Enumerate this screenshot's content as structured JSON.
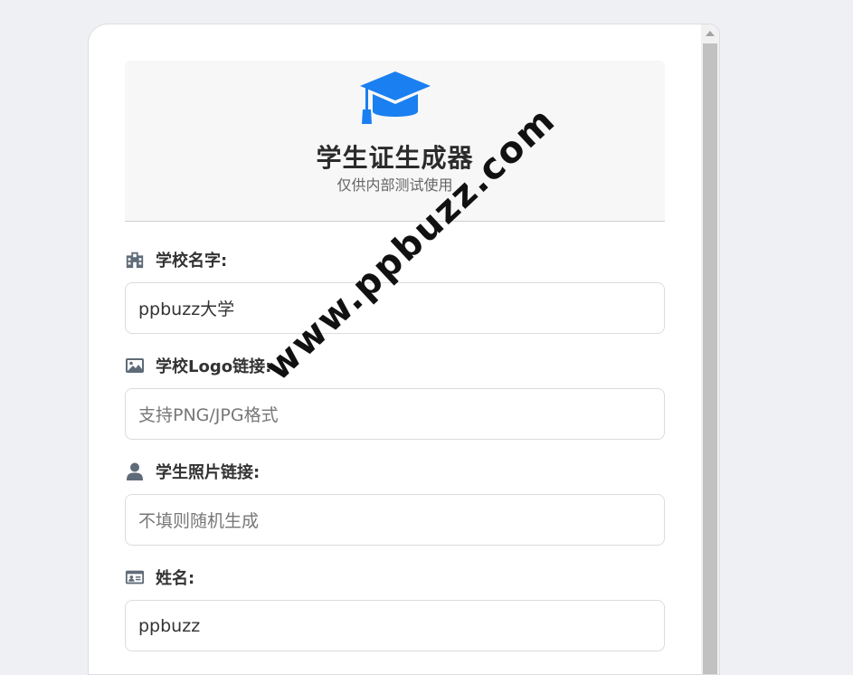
{
  "header": {
    "title": "学生证生成器",
    "subtitle": "仅供内部测试使用"
  },
  "fields": [
    {
      "label": "学校名字:",
      "icon": "school-icon",
      "value": "ppbuzz大学",
      "placeholder": ""
    },
    {
      "label": "学校Logo链接:",
      "icon": "image-icon",
      "value": "",
      "placeholder": "支持PNG/JPG格式"
    },
    {
      "label": "学生照片链接:",
      "icon": "user-icon",
      "value": "",
      "placeholder": "不填则随机生成"
    },
    {
      "label": "姓名:",
      "icon": "id-card-icon",
      "value": "ppbuzz",
      "placeholder": ""
    }
  ],
  "watermark": "www.ppbuzz.com",
  "colors": {
    "accent": "#1a7ff0",
    "icon_gray": "#5f6b78",
    "background": "#eff0f4"
  }
}
